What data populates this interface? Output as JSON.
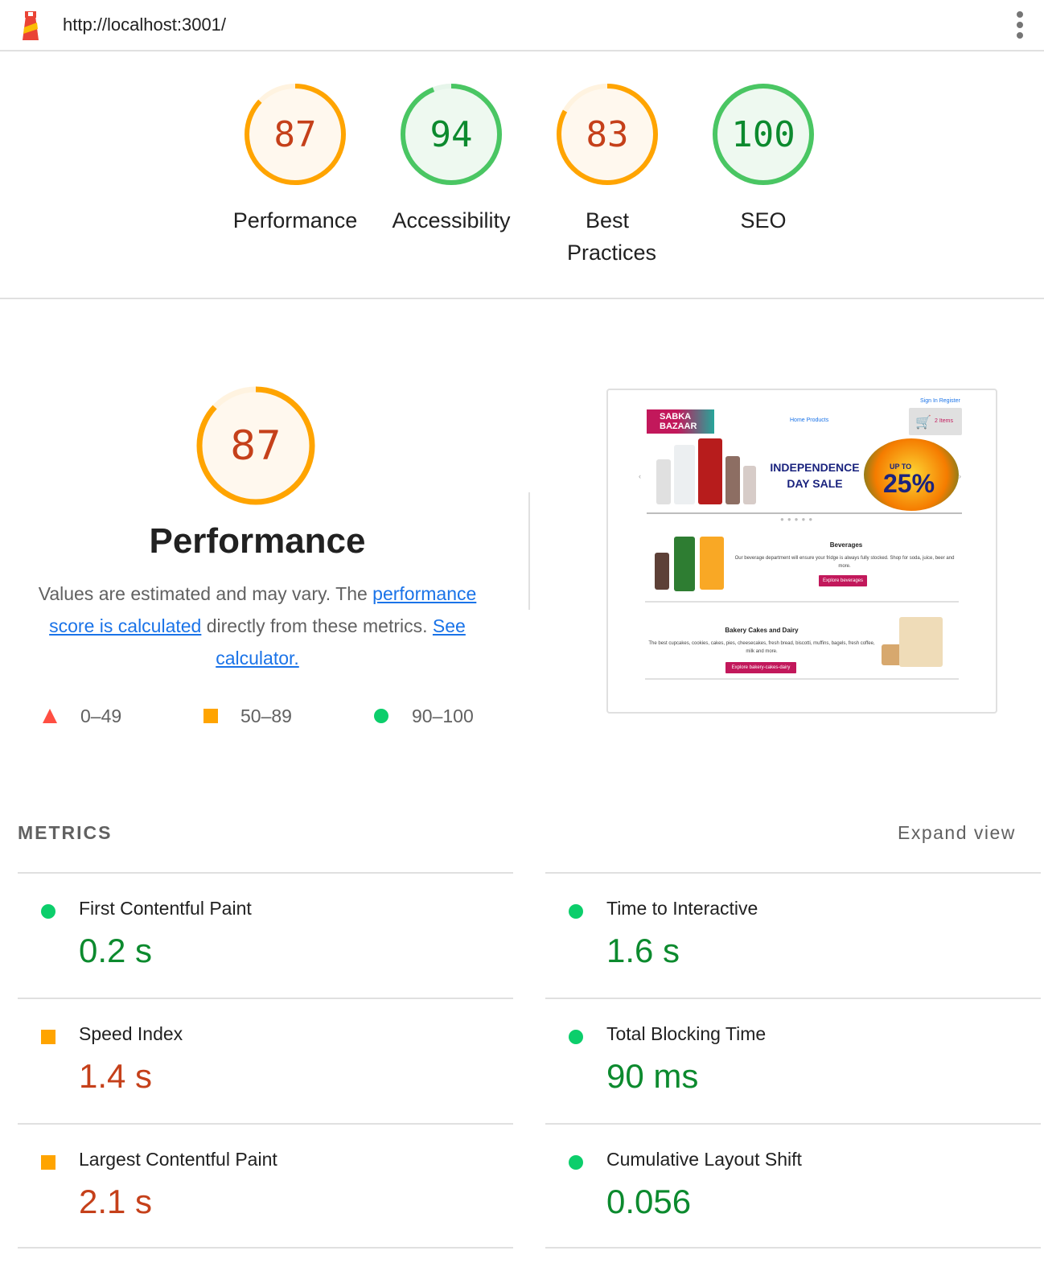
{
  "topbar": {
    "url": "http://localhost:3001/"
  },
  "colors": {
    "good": "#0cce6b",
    "average": "#ffa400",
    "poor": "#ff4e42",
    "good_text": "#0c8a2e",
    "avg_text": "#c5401a"
  },
  "gauges": [
    {
      "score": "87",
      "label": "Performance",
      "value": 0.87,
      "status": "average"
    },
    {
      "score": "94",
      "label": "Accessibility",
      "value": 0.94,
      "status": "good"
    },
    {
      "score": "83",
      "label": "Best Practices",
      "value": 0.83,
      "status": "average"
    },
    {
      "score": "100",
      "label": "SEO",
      "value": 1.0,
      "status": "good"
    }
  ],
  "performance": {
    "score": "87",
    "value": 0.87,
    "title": "Performance",
    "desc_pre": "Values are estimated and may vary. The ",
    "link1": "performance score is calculated",
    "desc_mid": " directly from these metrics. ",
    "link2": "See calculator."
  },
  "legend": [
    {
      "range": "0–49",
      "icon": "triangle-icon"
    },
    {
      "range": "50–89",
      "icon": "square-icon"
    },
    {
      "range": "90–100",
      "icon": "circle-icon"
    }
  ],
  "screenshot": {
    "nav_links": "Sign In   Register",
    "nav_center": "Home   Products",
    "brand": "SABKA BAZAAR",
    "cart_count": "2 Items",
    "sale": "INDEPENDENCE DAY SALE",
    "upto": "UP TO",
    "pct": "25%",
    "beverages_title": "Beverages",
    "beverages_text": "Our beverage department will ensure your fridge is always fully stocked. Shop for soda, juice, beer and more.",
    "beverages_btn": "Explore beverages",
    "bakery_title": "Bakery Cakes and Dairy",
    "bakery_text": "The best cupcakes, cookies, cakes, pies, cheesecakes, fresh bread, biscotti, muffins, bagels, fresh coffee, milk and more.",
    "bakery_btn": "Explore bakery-cakes-dairy"
  },
  "metrics": {
    "heading": "METRICS",
    "expand": "Expand view",
    "items": [
      {
        "name": "First Contentful Paint",
        "value": "0.2 s",
        "status": "good"
      },
      {
        "name": "Time to Interactive",
        "value": "1.6 s",
        "status": "good"
      },
      {
        "name": "Speed Index",
        "value": "1.4 s",
        "status": "average"
      },
      {
        "name": "Total Blocking Time",
        "value": "90 ms",
        "status": "good"
      },
      {
        "name": "Largest Contentful Paint",
        "value": "2.1 s",
        "status": "average"
      },
      {
        "name": "Cumulative Layout Shift",
        "value": "0.056",
        "status": "good"
      }
    ]
  }
}
